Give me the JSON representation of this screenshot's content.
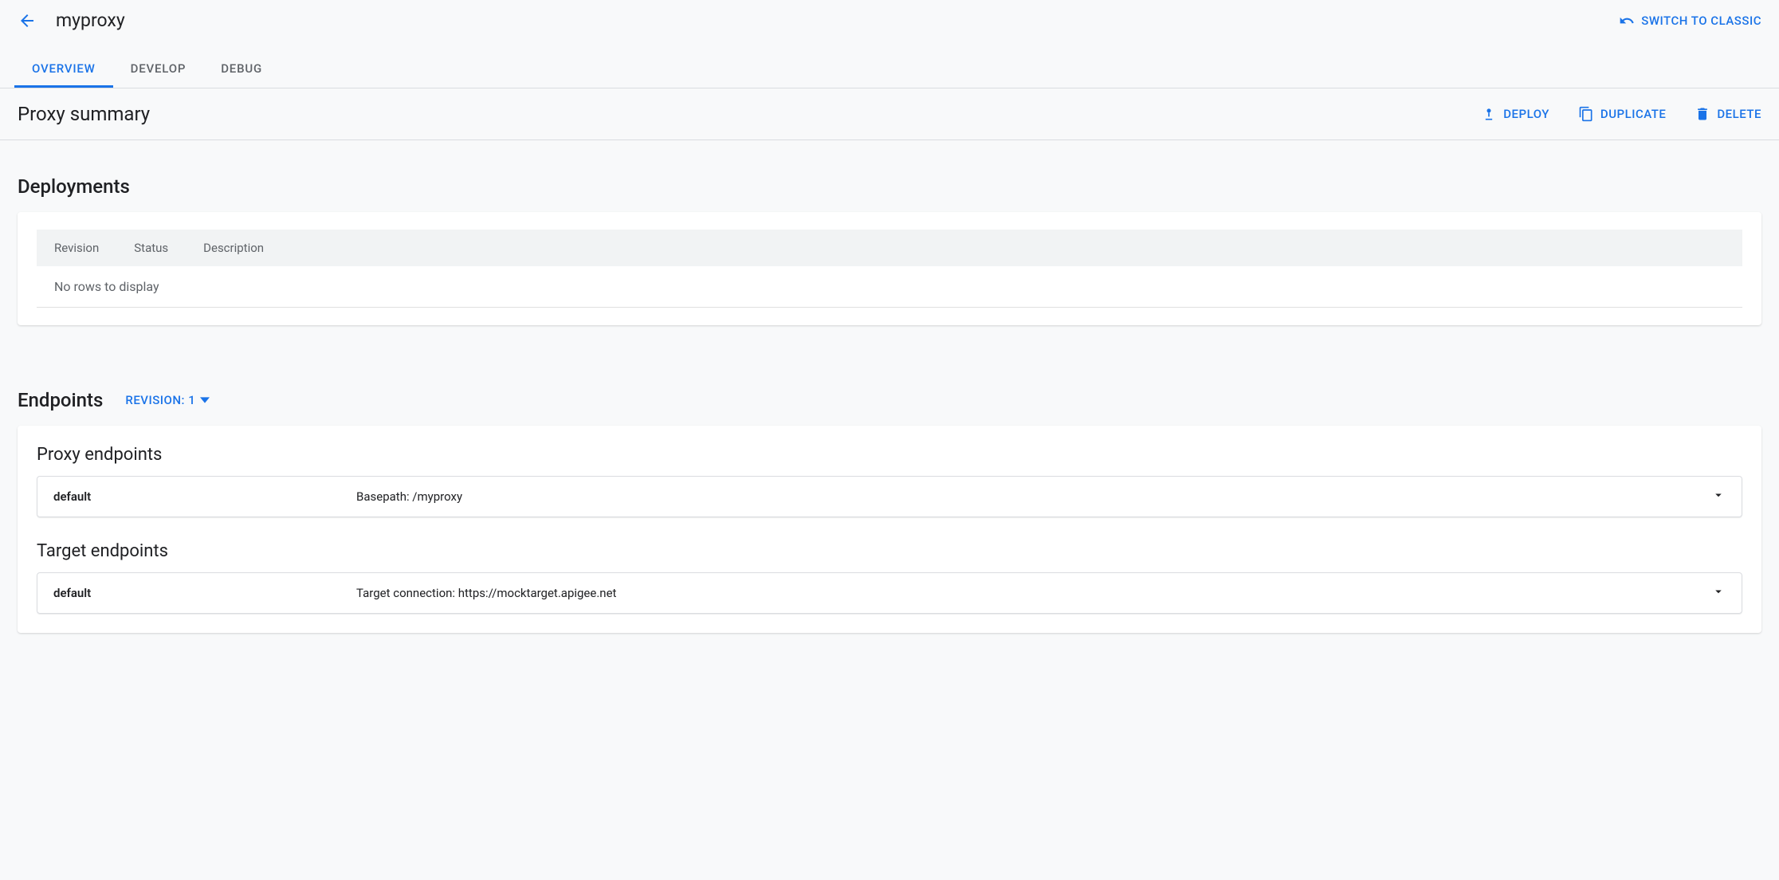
{
  "header": {
    "title": "myproxy",
    "switch_label": "SWITCH TO CLASSIC"
  },
  "tabs": [
    {
      "label": "OVERVIEW",
      "active": true
    },
    {
      "label": "DEVELOP",
      "active": false
    },
    {
      "label": "DEBUG",
      "active": false
    }
  ],
  "summary": {
    "title": "Proxy summary",
    "actions": {
      "deploy": "DEPLOY",
      "duplicate": "DUPLICATE",
      "delete": "DELETE"
    }
  },
  "deployments": {
    "title": "Deployments",
    "columns": [
      "Revision",
      "Status",
      "Description"
    ],
    "empty_text": "No rows to display"
  },
  "endpoints": {
    "title": "Endpoints",
    "revision_label": "REVISION: 1",
    "proxy": {
      "title": "Proxy endpoints",
      "row": {
        "name": "default",
        "detail": "Basepath: /myproxy"
      }
    },
    "target": {
      "title": "Target endpoints",
      "row": {
        "name": "default",
        "detail": "Target connection: https://mocktarget.apigee.net"
      }
    }
  }
}
